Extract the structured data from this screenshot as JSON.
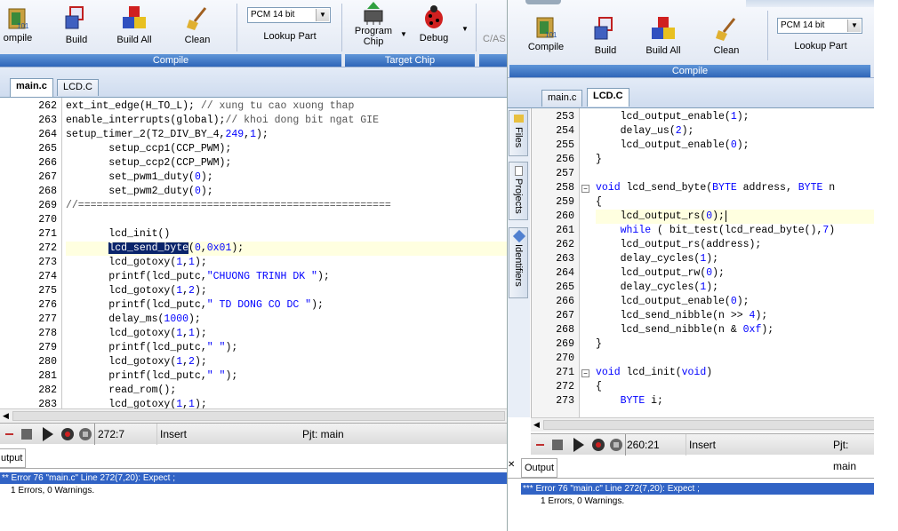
{
  "left": {
    "ribbon": {
      "compile_label": "ompile",
      "build_label": "Build",
      "build_all_label": "Build All",
      "clean_label": "Clean",
      "pcm_value": "PCM 14 bit",
      "lookup_label": "Lookup Part",
      "program_chip_label": "Program\nChip",
      "debug_label": "Debug",
      "cas_label": "C/AS",
      "group_compile": "Compile",
      "group_target": "Target Chip"
    },
    "tabs": [
      {
        "label": "main.c",
        "active": true
      },
      {
        "label": "LCD.C",
        "active": false
      }
    ],
    "gutter_start": 262,
    "lines": [
      "ext_int_edge(H_TO_L); // xung tu cao xuong thap",
      "enable_interrupts(global);// khoi dong bit ngat GIE",
      "setup_timer_2(T2_DIV_BY_4,249,1);",
      "       setup_ccp1(CCP_PWM);",
      "       setup_ccp2(CCP_PWM);",
      "       set_pwm1_duty(0);",
      "       set_pwm2_duty(0);",
      "//===================================================",
      "",
      "       lcd_init()",
      "       lcd_send_byte(0,0x01);",
      "       lcd_gotoxy(1,1);",
      "       printf(lcd_putc,\"CHUONG TRINH DK \");",
      "       lcd_gotoxy(1,2);",
      "       printf(lcd_putc,\" TD DONG CO DC \");",
      "       delay_ms(1000);",
      "       lcd_gotoxy(1,1);",
      "       printf(lcd_putc,\" \");",
      "       lcd_gotoxy(1,2);",
      "       printf(lcd_putc,\" \");",
      "       read_rom();",
      "       lcd_gotoxy(1,1);"
    ],
    "status": {
      "position": "272:7",
      "mode": "Insert",
      "project": "Pjt: main"
    },
    "output_tab": "utput",
    "error_line": "** Error 76 \"main.c\" Line 272(7,20): Expect ;",
    "summary_line": "1 Errors,  0 Warnings."
  },
  "right": {
    "ribbon": {
      "compile_label": "Compile",
      "build_label": "Build",
      "build_all_label": "Build All",
      "clean_label": "Clean",
      "pcm_value": "PCM 14 bit",
      "lookup_label": "Lookup Part",
      "group_compile": "Compile"
    },
    "tabs": [
      {
        "label": "main.c",
        "active": false
      },
      {
        "label": "LCD.C",
        "active": true
      }
    ],
    "side_tabs": [
      "Files",
      "Projects",
      "Identifiers"
    ],
    "gutter_start": 253,
    "lines": [
      "    lcd_output_enable(1);",
      "    delay_us(2);",
      "    lcd_output_enable(0);",
      "}",
      "",
      "void lcd_send_byte(BYTE address, BYTE n",
      "{",
      "    lcd_output_rs(0);",
      "    while ( bit_test(lcd_read_byte(),7)",
      "    lcd_output_rs(address);",
      "    delay_cycles(1);",
      "    lcd_output_rw(0);",
      "    delay_cycles(1);",
      "    lcd_output_enable(0);",
      "    lcd_send_nibble(n >> 4);",
      "    lcd_send_nibble(n & 0xf);",
      "}",
      "",
      "void lcd_init(void)",
      "{",
      "    BYTE i;"
    ],
    "status": {
      "position": "260:21",
      "mode": "Insert",
      "project": "Pjt: main"
    },
    "output_tab": "Output",
    "error_line": "*** Error 76 \"main.c\" Line 272(7,20): Expect ;",
    "summary_line": "1 Errors,  0 Warnings."
  },
  "colors": {
    "accent": "#3163c5",
    "selection": "#0a246a",
    "current_line": "#ffffe0",
    "keyword": "#0000ff"
  }
}
